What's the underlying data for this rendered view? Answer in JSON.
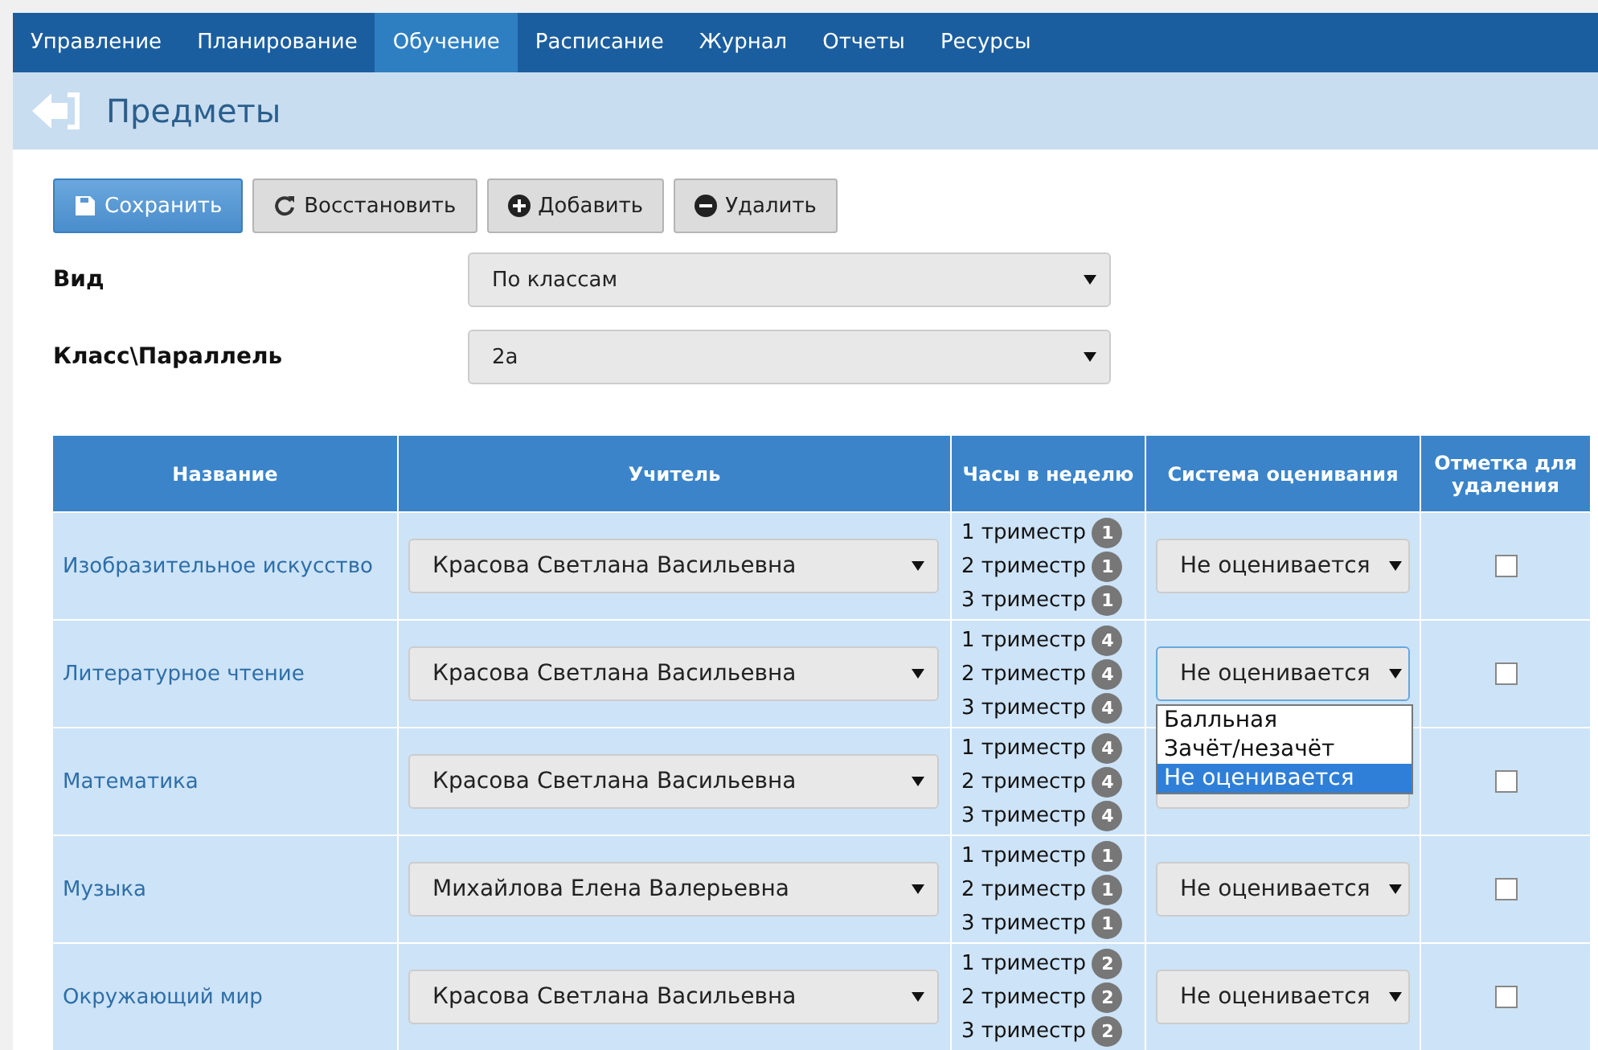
{
  "nav": [
    {
      "label": "Управление",
      "selected": false
    },
    {
      "label": "Планирование",
      "selected": false
    },
    {
      "label": "Обучение",
      "selected": true
    },
    {
      "label": "Расписание",
      "selected": false
    },
    {
      "label": "Журнал",
      "selected": false
    },
    {
      "label": "Отчеты",
      "selected": false
    },
    {
      "label": "Ресурсы",
      "selected": false
    }
  ],
  "page_title": "Предметы",
  "toolbar": [
    {
      "label": "Сохранить",
      "kind": "save"
    },
    {
      "label": "Восстановить",
      "kind": "restore"
    },
    {
      "label": "Добавить",
      "kind": "add"
    },
    {
      "label": "Удалить",
      "kind": "delete"
    }
  ],
  "filters": [
    {
      "label": "Вид",
      "value": "По классам"
    },
    {
      "label": "Класс\\Параллель",
      "value": "2а"
    }
  ],
  "table": {
    "columns": [
      "Название",
      "Учитель",
      "Часы в неделю",
      "Система оценивания",
      "Отметка для удаления"
    ],
    "rows": [
      {
        "name": "Изобразительное искусство",
        "teacher": "Красова Светлана Васильевна",
        "hours": [
          {
            "label": "1 триместр",
            "count": "1"
          },
          {
            "label": "2 триместр",
            "count": "1"
          },
          {
            "label": "3 триместр",
            "count": "1"
          }
        ],
        "grading": {
          "value": "Не оценивается",
          "open": false
        },
        "checked": false
      },
      {
        "name": "Литературное чтение",
        "teacher": "Красова Светлана Васильевна",
        "hours": [
          {
            "label": "1 триместр",
            "count": "4"
          },
          {
            "label": "2 триместр",
            "count": "4"
          },
          {
            "label": "3 триместр",
            "count": "4"
          }
        ],
        "grading": {
          "value": "Не оценивается",
          "open": true,
          "options": [
            {
              "label": "Балльная",
              "selected": false
            },
            {
              "label": "Зачёт/незачёт",
              "selected": false
            },
            {
              "label": "Не оценивается",
              "selected": true
            }
          ]
        },
        "checked": false
      },
      {
        "name": "Математика",
        "teacher": "Красова Светлана Васильевна",
        "hours": [
          {
            "label": "1 триместр",
            "count": "4"
          },
          {
            "label": "2 триместр",
            "count": "4"
          },
          {
            "label": "3 триместр",
            "count": "4"
          }
        ],
        "grading": {
          "open": false
        },
        "checked": false
      },
      {
        "name": "Музыка",
        "teacher": "Михайлова Елена Валерьевна",
        "hours": [
          {
            "label": "1 триместр",
            "count": "1"
          },
          {
            "label": "2 триместр",
            "count": "1"
          },
          {
            "label": "3 триместр",
            "count": "1"
          }
        ],
        "grading": {
          "value": "Не оценивается",
          "open": false
        },
        "checked": false
      },
      {
        "name": "Окружающий мир",
        "teacher": "Красова Светлана Васильевна",
        "hours": [
          {
            "label": "1 триместр",
            "count": "2"
          },
          {
            "label": "2 триместр",
            "count": "2"
          },
          {
            "label": "3 триместр",
            "count": "2"
          }
        ],
        "grading": {
          "value": "Не оценивается",
          "open": false
        },
        "checked": false
      }
    ]
  }
}
